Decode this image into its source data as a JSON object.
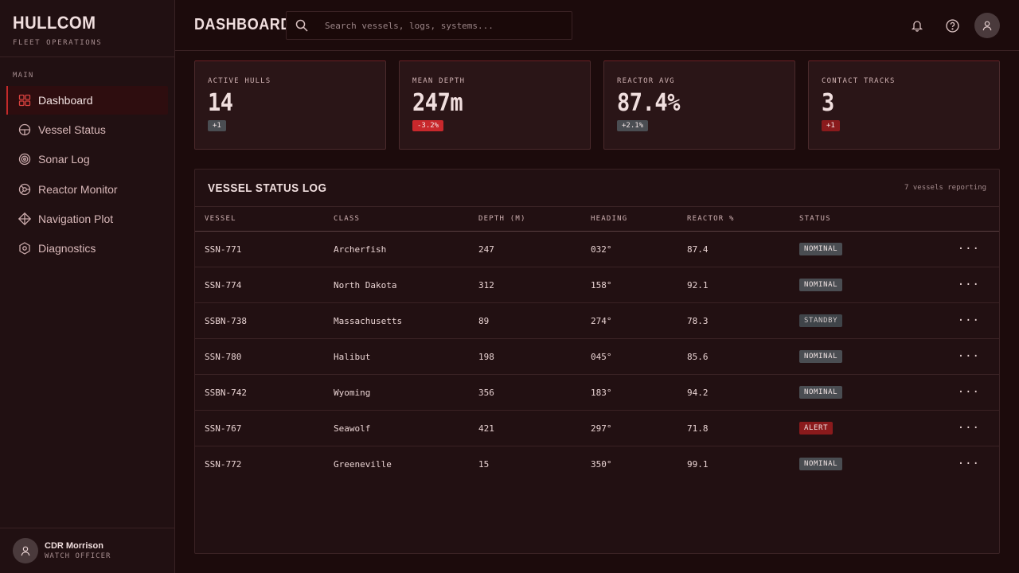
{
  "brand": {
    "title": "HULLCOM",
    "subtitle": "FLEET OPERATIONS"
  },
  "sidebar": {
    "section": "MAIN",
    "items": [
      {
        "label": "Dashboard",
        "icon": "grid-icon",
        "active": true
      },
      {
        "label": "Vessel Status",
        "icon": "hull-icon"
      },
      {
        "label": "Sonar Log",
        "icon": "sonar-icon"
      },
      {
        "label": "Reactor Monitor",
        "icon": "reactor-icon"
      },
      {
        "label": "Navigation Plot",
        "icon": "compass-icon"
      },
      {
        "label": "Diagnostics",
        "icon": "hex-gear-icon"
      }
    ]
  },
  "user": {
    "name": "CDR Morrison",
    "role": "WATCH OFFICER"
  },
  "header": {
    "title": "DASHBOARD",
    "search_placeholder": "Search vessels, logs, systems...",
    "icons": [
      "bell-icon",
      "help-icon",
      "avatar-icon"
    ]
  },
  "stats": [
    {
      "label": "ACTIVE HULLS",
      "value": "14",
      "delta": "+1",
      "tone": "neutral"
    },
    {
      "label": "MEAN DEPTH",
      "value": "247m",
      "delta": "-3.2%",
      "tone": "negative"
    },
    {
      "label": "REACTOR AVG",
      "value": "87.4%",
      "delta": "+2.1%",
      "tone": "neutral"
    },
    {
      "label": "CONTACT TRACKS",
      "value": "3",
      "delta": "+1",
      "tone": "alert"
    }
  ],
  "table": {
    "title": "VESSEL STATUS LOG",
    "meta": "7 vessels reporting",
    "columns": [
      "VESSEL",
      "CLASS",
      "DEPTH (M)",
      "HEADING",
      "REACTOR %",
      "STATUS"
    ],
    "rows": [
      {
        "vessel": "SSN-771",
        "class": "Archerfish",
        "depth": "247",
        "heading": "032°",
        "reactor": "87.4",
        "status": "NOMINAL"
      },
      {
        "vessel": "SSN-774",
        "class": "North Dakota",
        "depth": "312",
        "heading": "158°",
        "reactor": "92.1",
        "status": "NOMINAL"
      },
      {
        "vessel": "SSBN-738",
        "class": "Massachusetts",
        "depth": "89",
        "heading": "274°",
        "reactor": "78.3",
        "status": "STANDBY"
      },
      {
        "vessel": "SSN-780",
        "class": "Halibut",
        "depth": "198",
        "heading": "045°",
        "reactor": "85.6",
        "status": "NOMINAL"
      },
      {
        "vessel": "SSBN-742",
        "class": "Wyoming",
        "depth": "356",
        "heading": "183°",
        "reactor": "94.2",
        "status": "NOMINAL"
      },
      {
        "vessel": "SSN-767",
        "class": "Seawolf",
        "depth": "421",
        "heading": "297°",
        "reactor": "71.8",
        "status": "ALERT"
      },
      {
        "vessel": "SSN-772",
        "class": "Greeneville",
        "depth": "15",
        "heading": "350°",
        "reactor": "99.1",
        "status": "NOMINAL"
      }
    ]
  },
  "colors": {
    "accent": "#c42a2a",
    "background": "#1c0b0c",
    "panel": "#221012"
  }
}
